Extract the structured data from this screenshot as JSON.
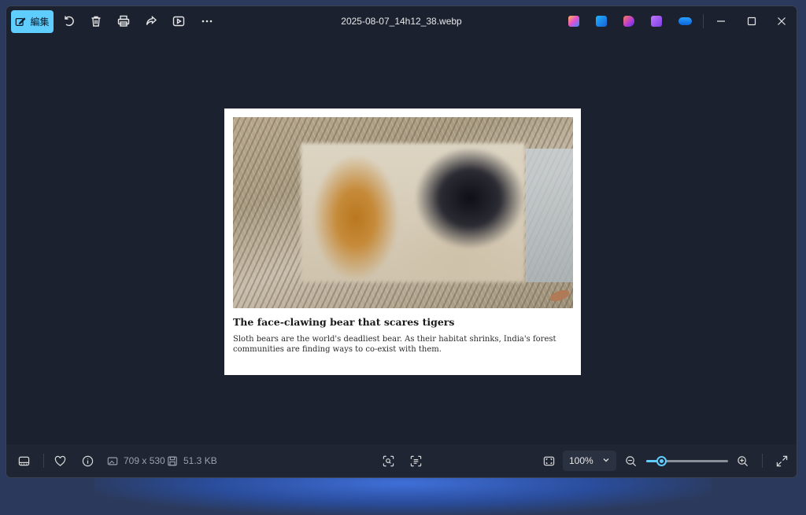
{
  "titlebar": {
    "edit_label": "編集",
    "filename": "2025-08-07_14h12_38.webp"
  },
  "article": {
    "headline": "The face-clawing bear that scares tigers",
    "summary": "Sloth bears are the world's deadliest bear. As their habitat shrinks, India's forest communities are finding ways to co-exist with them."
  },
  "statusbar": {
    "dimensions": "709 x 530",
    "filesize": "51.3 KB",
    "zoom_value": "100%",
    "zoom_slider_level": 0.18
  },
  "colors": {
    "accent": "#60cdff",
    "window_bg": "#1c2130"
  },
  "icons": {
    "titlebar_left": [
      "edit-icon",
      "rotate-icon",
      "delete-icon",
      "print-icon",
      "share-icon",
      "slideshow-icon",
      "more-icon"
    ],
    "titlebar_apps": [
      "copilot-icon",
      "designer-icon",
      "clipchamp-icon",
      "video-editor-icon",
      "onedrive-icon"
    ],
    "window_controls": [
      "minimize-icon",
      "maximize-icon",
      "close-icon"
    ],
    "statusbar": [
      "filmstrip-icon",
      "favorite-icon",
      "info-icon",
      "image-icon",
      "save-icon",
      "visual-search-icon",
      "text-scan-icon",
      "fit-window-icon",
      "zoom-out-icon",
      "zoom-in-icon",
      "fullscreen-icon"
    ]
  }
}
